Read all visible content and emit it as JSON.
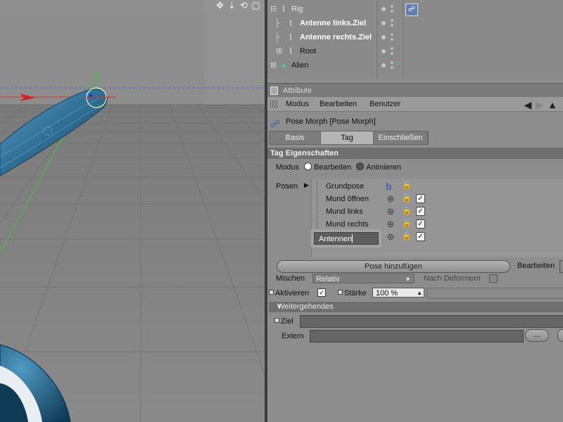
{
  "viewport": {
    "tool_icons": [
      "move-icon",
      "move-down-icon",
      "rotate-icon",
      "maximize-icon"
    ],
    "tool_glyphs": [
      "✥",
      "⇣",
      "⟲",
      "▢"
    ]
  },
  "object_manager": {
    "items": [
      {
        "name": "Rig",
        "type": "null-object"
      },
      {
        "name": "Antenne links.Ziel",
        "type": "null-object"
      },
      {
        "name": "Antenne rechts.Ziel",
        "type": "null-object"
      },
      {
        "name": "Root",
        "type": "null-object"
      },
      {
        "name": "Alien",
        "type": "polygon-object"
      }
    ]
  },
  "attributes": {
    "panel_title": "Attribute",
    "menu": [
      "Modus",
      "Bearbeiten",
      "Benutzer"
    ],
    "object_title": "Pose Morph [Pose Morph]",
    "tabs": [
      "Basis",
      "Tag",
      "Einschließen"
    ],
    "active_tab": "Tag",
    "section_title": "Tag Eigenschaften",
    "modus": {
      "label": "Modus",
      "options": [
        "Bearbeiten",
        "Animieren"
      ],
      "selected": "Bearbeiten"
    },
    "posen": {
      "label": "Posen",
      "items": [
        "Grundpose",
        "Mund öffnen",
        "Mund links",
        "Mund rechts"
      ],
      "editing_value": "Antennen"
    },
    "pose_add_button": "Pose hinzufügen",
    "bearbeiten_label": "Bearbeiten",
    "mischen": {
      "label": "Mischen",
      "value": "Relativ"
    },
    "nach_deformern": "Nach Deformern",
    "aktivieren": "Aktivieren",
    "staerke": {
      "label": "Stärke",
      "value": "100 %"
    },
    "weitergehendes": "Weitergehendes",
    "ziel_label": "Ziel",
    "extern_label": "Extern",
    "extern_button": "..."
  }
}
